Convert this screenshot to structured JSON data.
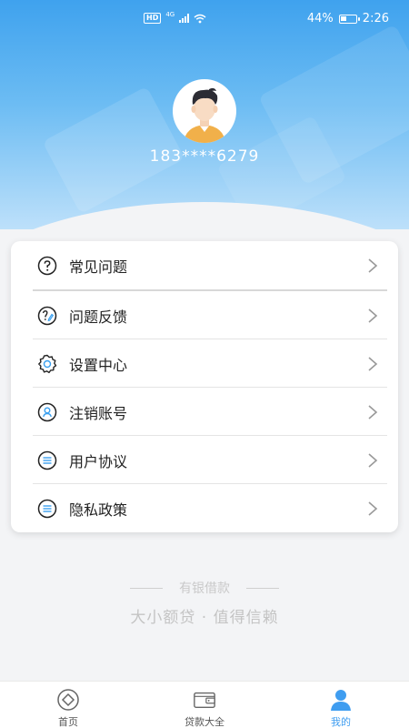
{
  "status_bar": {
    "hd": "HD",
    "network": "4G",
    "battery": "44%",
    "battery_level": 0.44,
    "time": "2:26"
  },
  "profile": {
    "phone": "183****6279"
  },
  "menu": {
    "items": [
      {
        "label": "常见问题",
        "icon": "question-icon"
      },
      {
        "label": "问题反馈",
        "icon": "feedback-icon"
      },
      {
        "label": "设置中心",
        "icon": "settings-gear-icon"
      },
      {
        "label": "注销账号",
        "icon": "user-icon"
      },
      {
        "label": "用户协议",
        "icon": "list-icon"
      },
      {
        "label": "隐私政策",
        "icon": "list-icon"
      }
    ]
  },
  "footer": {
    "brand": "有银借款",
    "slogan": "大小额贷 · 值得信赖"
  },
  "nav": {
    "items": [
      {
        "label": "首页",
        "icon": "home-diamond-icon",
        "active": false
      },
      {
        "label": "贷款大全",
        "icon": "wallet-icon",
        "active": false
      },
      {
        "label": "我的",
        "icon": "person-icon",
        "active": true
      }
    ]
  },
  "colors": {
    "accent": "#3f9df0",
    "header_top": "#3fa2ee"
  }
}
